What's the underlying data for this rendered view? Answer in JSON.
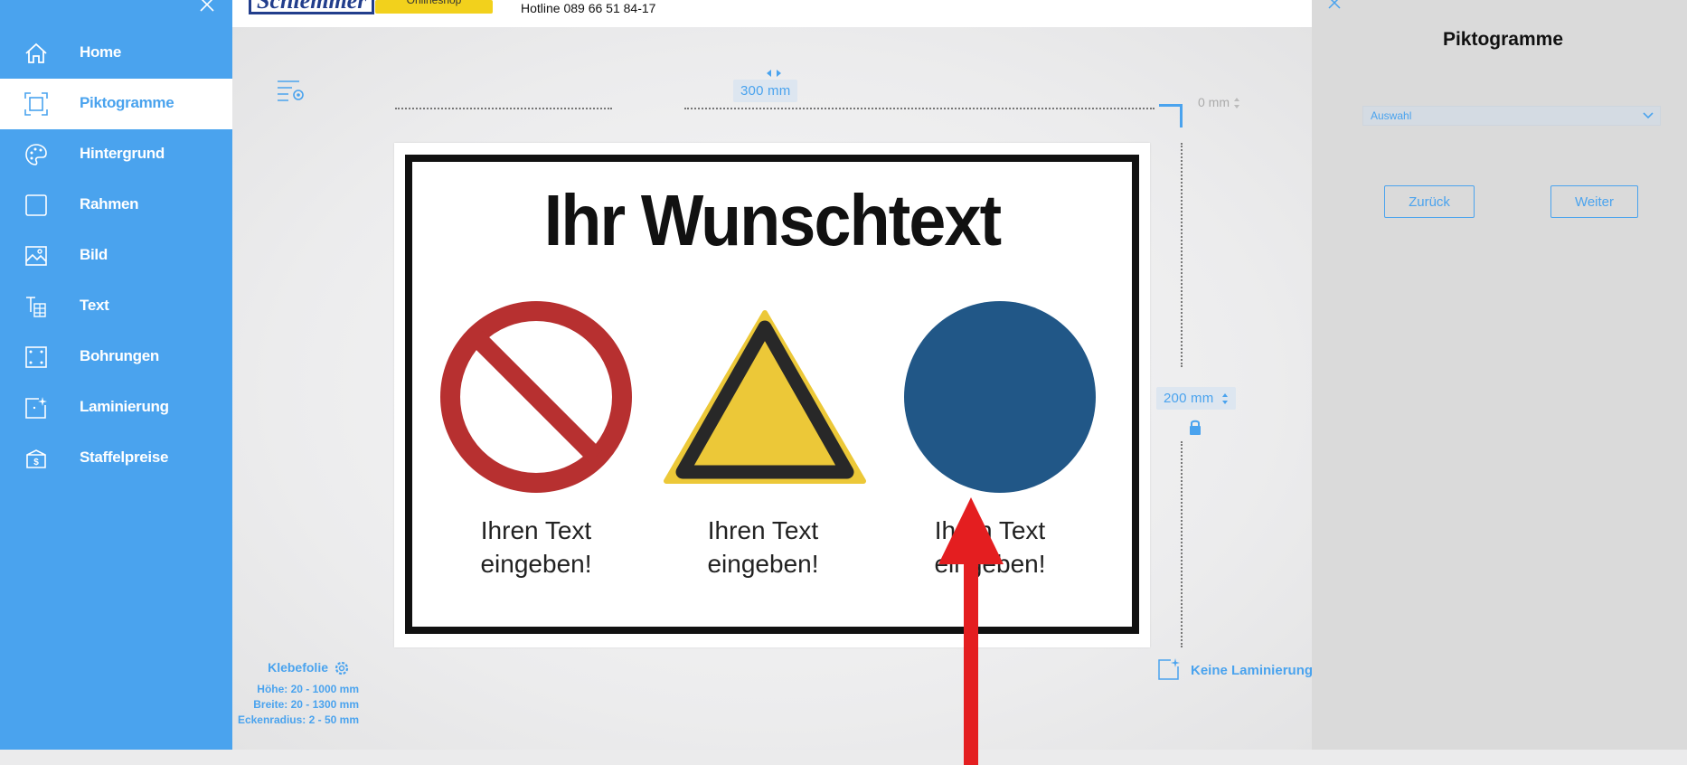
{
  "sidebar": {
    "items": [
      {
        "label": "Home",
        "icon": "home-icon"
      },
      {
        "label": "Piktogramme",
        "icon": "frame-icon",
        "active": true
      },
      {
        "label": "Hintergrund",
        "icon": "palette-icon"
      },
      {
        "label": "Rahmen",
        "icon": "square-icon"
      },
      {
        "label": "Bild",
        "icon": "image-icon"
      },
      {
        "label": "Text",
        "icon": "text-icon"
      },
      {
        "label": "Bohrungen",
        "icon": "drill-holes-icon"
      },
      {
        "label": "Laminierung",
        "icon": "lamination-icon"
      },
      {
        "label": "Staffelpreise",
        "icon": "price-box-icon"
      }
    ]
  },
  "header": {
    "logo": "Schlemmer",
    "shop_button": "Onlineshop",
    "hotline": "Hotline 089 66 51 84-17"
  },
  "editor": {
    "width_label": "300  mm",
    "height_label": "200  mm",
    "corner_label": "0  mm",
    "material": "Klebefolie",
    "specs": [
      "Höhe: 20 - 1000 mm",
      "Breite: 20 - 1300 mm",
      "Eckenradius: 2 - 50 mm"
    ],
    "lamination": "Keine Laminierung"
  },
  "sign": {
    "title": "Ihr Wunschtext",
    "captions": [
      [
        "Ihren Text",
        "eingeben!"
      ],
      [
        "Ihren Text",
        "eingeben!"
      ],
      [
        "Ihren Text",
        "eingeben!"
      ]
    ]
  },
  "panel": {
    "title": "Piktogramme",
    "select_value": "Auswahl",
    "back_label": "Zurück",
    "next_label": "Weiter"
  },
  "colors": {
    "accent": "#4aa3ee",
    "prohibition_red": "#b73030",
    "warning_yellow": "#ecc838",
    "mandatory_blue": "#215787",
    "arrow_red": "#e41e20"
  }
}
